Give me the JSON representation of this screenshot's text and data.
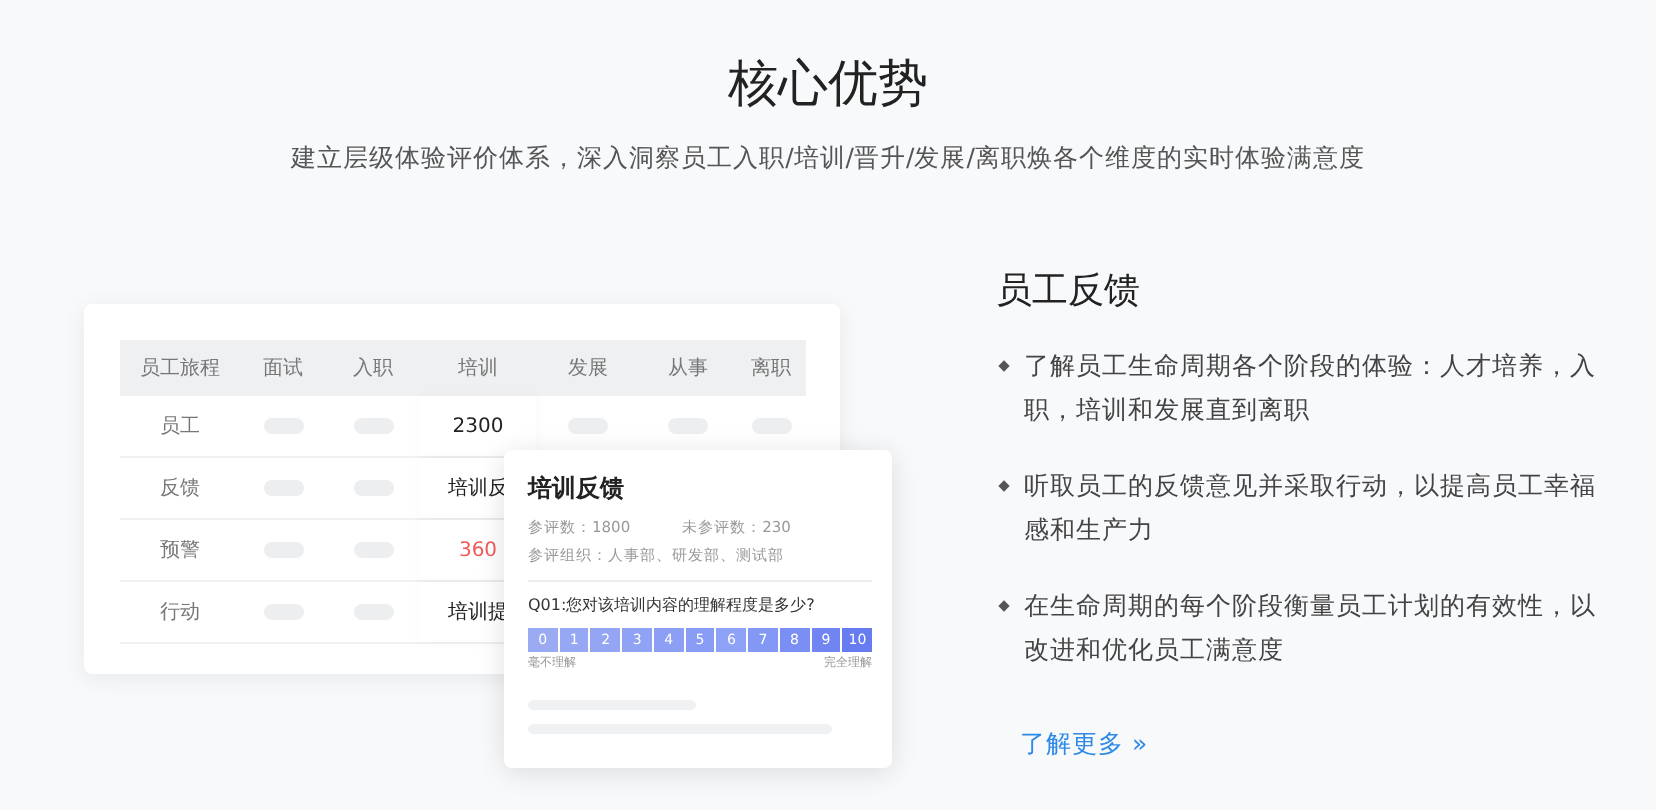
{
  "header": {
    "title": "核心优势",
    "subtitle": "建立层级体验评价体系，深入洞察员工入职/培训/晋升/发展/离职焕各个维度的实时体验满意度"
  },
  "table": {
    "columns": [
      "员工旅程",
      "面试",
      "入职",
      "培训",
      "发展",
      "从事",
      "离职"
    ],
    "rows": [
      {
        "label": "员工",
        "cells": [
          {
            "kind": "pill"
          },
          {
            "kind": "pill"
          },
          {
            "kind": "text",
            "text": "2300"
          },
          {
            "kind": "pill"
          },
          {
            "kind": "pill"
          },
          {
            "kind": "pill"
          }
        ]
      },
      {
        "label": "反馈",
        "cells": [
          {
            "kind": "pill"
          },
          {
            "kind": "pill"
          },
          {
            "kind": "text",
            "text": "培训反"
          }
        ]
      },
      {
        "label": "预警",
        "cells": [
          {
            "kind": "pill"
          },
          {
            "kind": "pill"
          },
          {
            "kind": "alert",
            "text": "360"
          }
        ]
      },
      {
        "label": "行动",
        "cells": [
          {
            "kind": "pill"
          },
          {
            "kind": "pill"
          },
          {
            "kind": "text",
            "text": "培训提"
          }
        ]
      }
    ]
  },
  "popup": {
    "title": "培训反馈",
    "stats": [
      "参评数：1800",
      "未参评数：230"
    ],
    "org": "参评组织：人事部、研发部、测试部",
    "question": "Q01:您对该培训内容的理解程度是多少?",
    "scale": [
      {
        "label": "0",
        "color": "#9aabf3"
      },
      {
        "label": "1",
        "color": "#96a8f3"
      },
      {
        "label": "2",
        "color": "#93a5f3"
      },
      {
        "label": "3",
        "color": "#8fa2f4"
      },
      {
        "label": "4",
        "color": "#8c9ff4"
      },
      {
        "label": "5",
        "color": "#889cf5"
      },
      {
        "label": "6",
        "color": "#8da1f6"
      },
      {
        "label": "7",
        "color": "#8398f5"
      },
      {
        "label": "8",
        "color": "#7a8ff4"
      },
      {
        "label": "9",
        "color": "#7085f2"
      },
      {
        "label": "10",
        "color": "#667cf0"
      }
    ],
    "scale_min": "毫不理解",
    "scale_max": "完全理解"
  },
  "feature": {
    "title": "员工反馈",
    "bullets": [
      "了解员工生命周期各个阶段的体验：人才培养，入职，培训和发展直到离职",
      "听取员工的反馈意见并采取行动，以提高员工幸福感和生产力",
      "在生命周期的每个阶段衡量员工计划的有效性，以改进和优化员工满意度"
    ],
    "link": "了解更多 »"
  }
}
